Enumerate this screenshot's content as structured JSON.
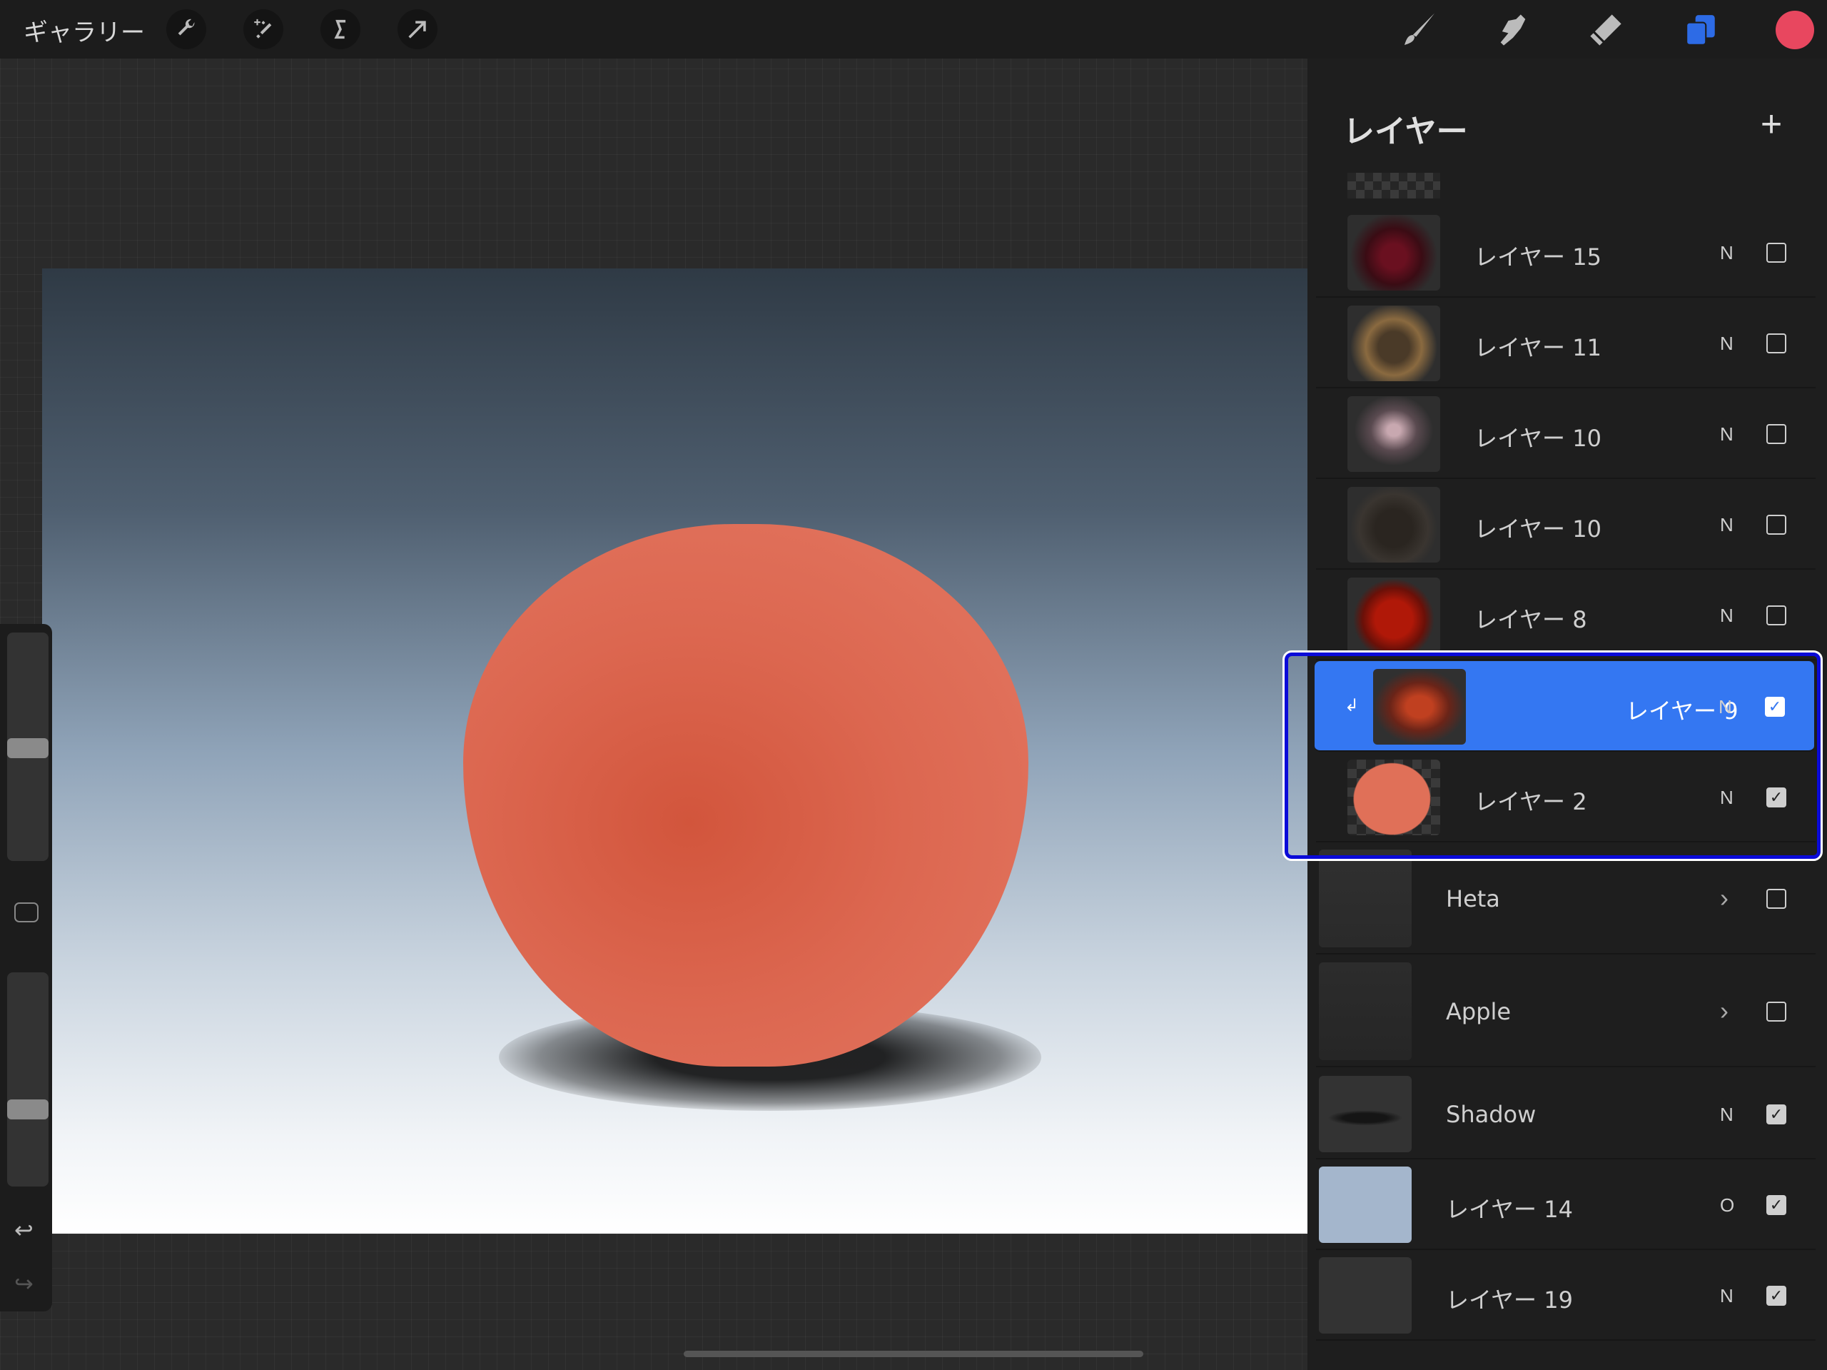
{
  "topbar": {
    "gallery_label": "ギャラリー",
    "left_tools": [
      "wrench-icon",
      "magic-wand-icon",
      "selection-icon",
      "transform-arrow-icon"
    ],
    "right_tools": [
      "brush-icon",
      "smudge-icon",
      "eraser-icon",
      "layers-icon",
      "color-swatch"
    ],
    "current_color": "#e8475f",
    "accent": "#3477f2"
  },
  "sidebar": {
    "brush_size": 0.48,
    "opacity": 0.38
  },
  "layers": {
    "title": "レイヤー",
    "add_label": "+",
    "items": [
      {
        "name": "レイヤー 15",
        "mode": "N",
        "visible": false
      },
      {
        "name": "レイヤー 11",
        "mode": "N",
        "visible": false
      },
      {
        "name": "レイヤー 10",
        "mode": "N",
        "visible": false
      },
      {
        "name": "レイヤー 10",
        "mode": "N",
        "visible": false
      },
      {
        "name": "レイヤー 8",
        "mode": "N",
        "visible": false
      },
      {
        "name": "レイヤー 9",
        "mode": "N",
        "visible": true,
        "selected": true,
        "clipped": true
      },
      {
        "name": "レイヤー 2",
        "mode": "N",
        "visible": true
      },
      {
        "name": "Heta",
        "group": true,
        "visible": false
      },
      {
        "name": "Apple",
        "group": true,
        "visible": false
      },
      {
        "name": "Shadow",
        "mode": "N",
        "visible": true
      },
      {
        "name": "レイヤー 14",
        "mode": "O",
        "visible": true
      },
      {
        "name": "レイヤー 19",
        "mode": "N",
        "visible": true
      }
    ]
  }
}
